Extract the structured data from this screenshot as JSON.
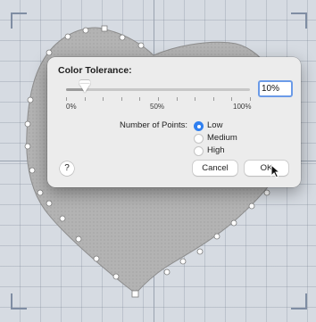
{
  "dialog": {
    "title": "Color Tolerance:",
    "tolerance_value": "10%",
    "tolerance_fraction": 0.1,
    "scale_labels": [
      "0%",
      "50%",
      "100%"
    ],
    "points_label": "Number of Points:",
    "options": [
      {
        "label": "Low",
        "selected": true
      },
      {
        "label": "Medium",
        "selected": false
      },
      {
        "label": "High",
        "selected": false
      }
    ],
    "help_label": "?",
    "cancel_label": "Cancel",
    "ok_label": "OK"
  },
  "colors": {
    "accent": "#2f7ff0",
    "shape_fill": "#b3b3b3",
    "canvas": "#d6dbe2"
  }
}
